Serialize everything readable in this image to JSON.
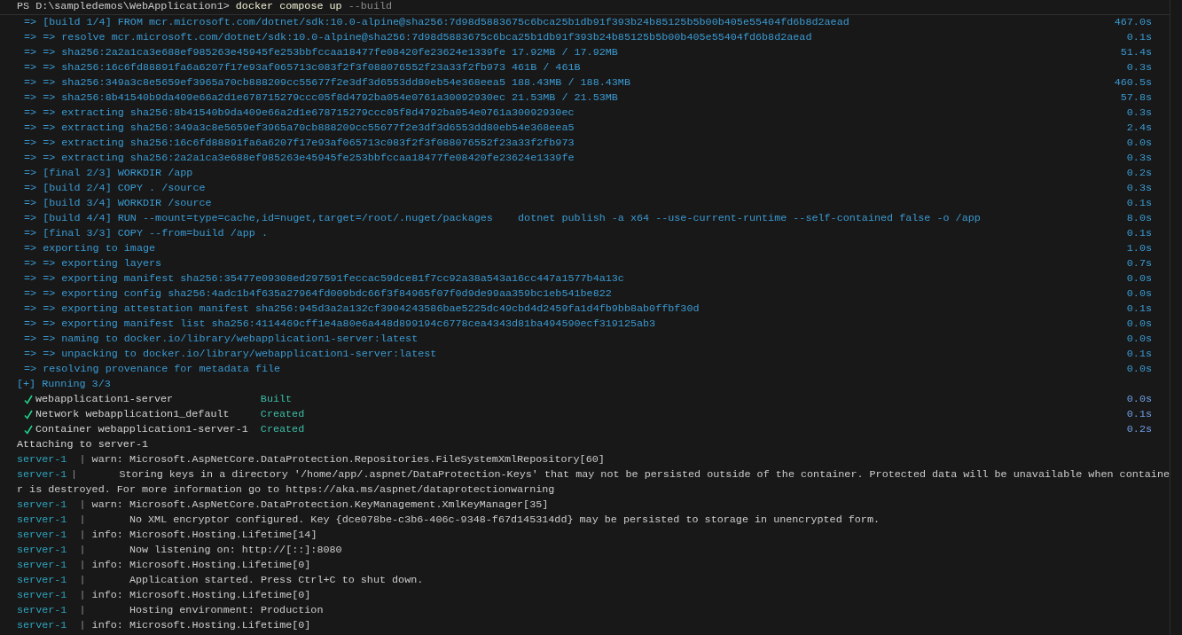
{
  "prompt": {
    "path": "PS D:\\sampledemos\\WebApplication1>",
    "command": "docker compose up",
    "flag": "--build"
  },
  "build_steps": [
    {
      "text": "=> [build 1/4] FROM mcr.microsoft.com/dotnet/sdk:10.0-alpine@sha256:7d98d5883675c6bca25b1db91f393b24b85125b5b00b405e55404fd6b8d2aead",
      "time": "467.0s"
    },
    {
      "text": "=> => resolve mcr.microsoft.com/dotnet/sdk:10.0-alpine@sha256:7d98d5883675c6bca25b1db91f393b24b85125b5b00b405e55404fd6b8d2aead",
      "time": "0.1s"
    },
    {
      "text": "=> => sha256:2a2a1ca3e688ef985263e45945fe253bbfccaa18477fe08420fe23624e1339fe 17.92MB / 17.92MB",
      "time": "51.4s"
    },
    {
      "text": "=> => sha256:16c6fd88891fa6a6207f17e93af065713c083f2f3f088076552f23a33f2fb973 461B / 461B",
      "time": "0.3s"
    },
    {
      "text": "=> => sha256:349a3c8e5659ef3965a70cb888209cc55677f2e3df3d6553dd80eb54e368eea5 188.43MB / 188.43MB",
      "time": "460.5s"
    },
    {
      "text": "=> => sha256:8b41540b9da409e66a2d1e678715279ccc05f8d4792ba054e0761a30092930ec 21.53MB / 21.53MB",
      "time": "57.8s"
    },
    {
      "text": "=> => extracting sha256:8b41540b9da409e66a2d1e678715279ccc05f8d4792ba054e0761a30092930ec",
      "time": "0.3s"
    },
    {
      "text": "=> => extracting sha256:349a3c8e5659ef3965a70cb888209cc55677f2e3df3d6553dd80eb54e368eea5",
      "time": "2.4s"
    },
    {
      "text": "=> => extracting sha256:16c6fd88891fa6a6207f17e93af065713c083f2f3f088076552f23a33f2fb973",
      "time": "0.0s"
    },
    {
      "text": "=> => extracting sha256:2a2a1ca3e688ef985263e45945fe253bbfccaa18477fe08420fe23624e1339fe",
      "time": "0.3s"
    },
    {
      "text": "=> [final 2/3] WORKDIR /app",
      "time": "0.2s"
    },
    {
      "text": "=> [build 2/4] COPY . /source",
      "time": "0.3s"
    },
    {
      "text": "=> [build 3/4] WORKDIR /source",
      "time": "0.1s"
    },
    {
      "text": "=> [build 4/4] RUN --mount=type=cache,id=nuget,target=/root/.nuget/packages    dotnet publish -a x64 --use-current-runtime --self-contained false -o /app",
      "time": "8.0s"
    },
    {
      "text": "=> [final 3/3] COPY --from=build /app .",
      "time": "0.1s"
    },
    {
      "text": "=> exporting to image",
      "time": "1.0s"
    },
    {
      "text": "=> => exporting layers",
      "time": "0.7s"
    },
    {
      "text": "=> => exporting manifest sha256:35477e09308ed297591feccac59dce81f7cc92a38a543a16cc447a1577b4a13c",
      "time": "0.0s"
    },
    {
      "text": "=> => exporting config sha256:4adc1b4f635a27964fd009bdc66f3f84965f07f0d9de99aa359bc1eb541be822",
      "time": "0.0s"
    },
    {
      "text": "=> => exporting attestation manifest sha256:945d3a2a132cf3904243586bae5225dc49cbd4d2459fa1d4fb9bb8ab0ffbf30d",
      "time": "0.1s"
    },
    {
      "text": "=> => exporting manifest list sha256:4114469cff1e4a80e6a448d899194c6778cea4343d81ba494590ecf319125ab3",
      "time": "0.0s"
    },
    {
      "text": "=> => naming to docker.io/library/webapplication1-server:latest",
      "time": "0.0s"
    },
    {
      "text": "=> => unpacking to docker.io/library/webapplication1-server:latest",
      "time": "0.1s"
    },
    {
      "text": "=> resolving provenance for metadata file",
      "time": "0.0s"
    }
  ],
  "status": "[+] Running 3/3",
  "services": [
    {
      "done": true,
      "name": "webapplication1-server",
      "state": "Built",
      "time": "0.0s"
    },
    {
      "done": true,
      "name": "Network webapplication1_default",
      "state": "Created",
      "time": "0.1s"
    },
    {
      "done": true,
      "name": "Container webapplication1-server-1",
      "state": "Created",
      "time": "0.2s"
    }
  ],
  "attach": "Attaching to server-1",
  "logs": [
    {
      "kind": "entry",
      "source": "server-1",
      "separator": "|",
      "message": "warn: Microsoft.AspNetCore.DataProtection.Repositories.FileSystemXmlRepository[60]"
    },
    {
      "kind": "detail",
      "source": "server-1",
      "separator": "|",
      "message": "Storing keys in a directory '/home/app/.aspnet/DataProtection-Keys' that may not be persisted outside of the container. Protected data will be unavailable when containe"
    },
    {
      "kind": "wrap",
      "message": "r is destroyed. For more information go to https://aka.ms/aspnet/dataprotectionwarning"
    },
    {
      "kind": "entry",
      "source": "server-1",
      "separator": "|",
      "message": "warn: Microsoft.AspNetCore.DataProtection.KeyManagement.XmlKeyManager[35]"
    },
    {
      "kind": "detail",
      "source": "server-1",
      "separator": "|",
      "message": "No XML encryptor configured. Key {dce078be-c3b6-406c-9348-f67d145314dd} may be persisted to storage in unencrypted form."
    },
    {
      "kind": "entry",
      "source": "server-1",
      "separator": "|",
      "message": "info: Microsoft.Hosting.Lifetime[14]"
    },
    {
      "kind": "detail",
      "source": "server-1",
      "separator": "|",
      "message": "Now listening on: http://[::]:8080"
    },
    {
      "kind": "entry",
      "source": "server-1",
      "separator": "|",
      "message": "info: Microsoft.Hosting.Lifetime[0]"
    },
    {
      "kind": "detail",
      "source": "server-1",
      "separator": "|",
      "message": "Application started. Press Ctrl+C to shut down."
    },
    {
      "kind": "entry",
      "source": "server-1",
      "separator": "|",
      "message": "info: Microsoft.Hosting.Lifetime[0]"
    },
    {
      "kind": "detail",
      "source": "server-1",
      "separator": "|",
      "message": "Hosting environment: Production"
    },
    {
      "kind": "entry",
      "source": "server-1",
      "separator": "|",
      "message": "info: Microsoft.Hosting.Lifetime[0]"
    }
  ]
}
